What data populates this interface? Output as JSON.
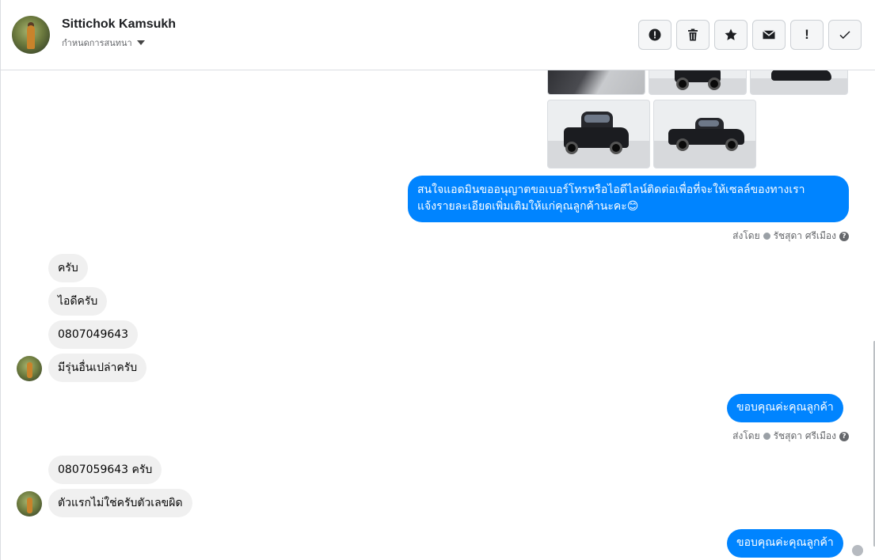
{
  "header": {
    "name": "Sittichok Kamsukh",
    "subtitle": "กำหนดการสนทนา",
    "actions": [
      {
        "name": "spam-report-button",
        "icon": "alert-circle-icon"
      },
      {
        "name": "delete-button",
        "icon": "trash-icon"
      },
      {
        "name": "star-button",
        "icon": "star-icon"
      },
      {
        "name": "mark-unread-button",
        "icon": "envelope-icon"
      },
      {
        "name": "important-button",
        "icon": "exclamation-icon",
        "label": "!"
      },
      {
        "name": "mark-done-button",
        "icon": "check-icon"
      }
    ]
  },
  "messages": {
    "out1": "สนใจแอดมินขออนุญาตขอเบอร์โทรหรือไอดีไลน์ติดต่อเพื่อที่จะให้เซลล์ของทางเรา",
    "out1_line2": "แจ้งรายละเอียดเพิ่มเติมให้แก่คุณลูกค้านะคะ😊",
    "sent_by_label": "ส่งโดย",
    "sent_by_name": "รัชสุดา ศรีเมือง",
    "help_glyph": "?",
    "in1": "ครับ",
    "in2": "ไอดีครับ",
    "in3": "0807049643",
    "in4": "มีรุ่นอื่นเปล่าครับ",
    "out2": "ขอบคุณค่ะคุณลูกค้า",
    "in5": "0807059643 ครับ",
    "in6": "ตัวแรกไม่ใช่ครับตัวเลขผิด",
    "out3": "ขอบคุณค่ะคุณลูกค้า"
  },
  "colors": {
    "outgoing_bubble": "#0084ff",
    "incoming_bubble": "#f0f0f0"
  }
}
